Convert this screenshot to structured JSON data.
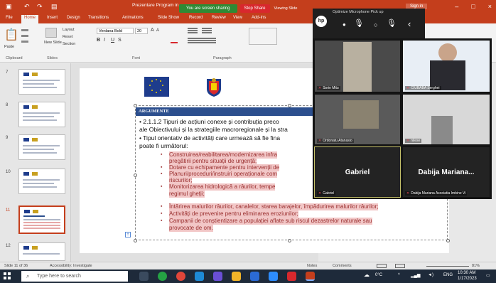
{
  "window": {
    "title": "Prezentare Program in...",
    "signin": "Sign in",
    "controls": [
      "–",
      "□",
      "×"
    ]
  },
  "sharing": {
    "status": "You are screen sharing",
    "stop": "Stop Share",
    "viewing": "Viewing Slide"
  },
  "ribbon": {
    "tabs": [
      "File",
      "Home",
      "Insert",
      "Design",
      "Transitions",
      "Animations",
      "Slide Show",
      "Record",
      "Review",
      "View",
      "Add-ins"
    ],
    "groups": [
      "Clipboard",
      "Slides",
      "Font",
      "Paragraph"
    ],
    "clipboard": {
      "paste": "Paste"
    },
    "slides": {
      "new_slide": "New Slide",
      "layout": "Layout",
      "reset": "Reset",
      "section": "Section"
    },
    "font": {
      "name": "Verdana Bold",
      "size": "20"
    }
  },
  "zoom_toolbar": {
    "label": "Optimize Microphone Pick up"
  },
  "thumbnails": [
    {
      "num": "7"
    },
    {
      "num": "8"
    },
    {
      "num": "9"
    },
    {
      "num": "10"
    },
    {
      "num": "11"
    },
    {
      "num": "12"
    }
  ],
  "slide": {
    "header": "ARGUMENTE",
    "line1": "• 2.1.1.2 Tipuri de acțiuni conexe și contribuția preco",
    "line2": "ale Obiectivului și la strategiile macroregionale și la stra",
    "line3": "• Tipul orientativ de activități care urmează să fie fina",
    "line4": "poate fi următorul:",
    "bullets": [
      [
        "Construirea/reabilitarea/modernizarea  infra",
        "pregătirii pentru situații de urgență;"
      ],
      [
        "Dotare cu echipamente pentru intervenții de"
      ],
      [
        "Planuri/proceduri/instruiri operaționale com",
        "riscurilor;"
      ],
      [
        "Monitorizarea  hidrologică  a  râurilor,  tempe",
        "regimul gheții;"
      ],
      [
        "Întărirea malurilor râurilor, canalelor, starea barajelor, împădurirea malurilor râurilor;"
      ],
      [
        "Activități de prevenire pentru eliminarea eroziunilor;"
      ],
      [
        "Campanii  de  conștientizare  a  populației  aflate  sub  riscul  dezastrelor  naturale  sau",
        "provocate de om."
      ]
    ]
  },
  "participants": [
    {
      "name": "Sorin Mitu"
    },
    {
      "name": "CIUBABA Serghei"
    },
    {
      "name": "Ordonatu Atanasio"
    },
    {
      "name": "nilese"
    },
    {
      "name": "Gabriel",
      "big": "Gabriel"
    },
    {
      "name": "Dabija Mariana Asociatia Imbine Vi",
      "big": "Dabija Mariana..."
    }
  ],
  "statusbar": {
    "slide_of": "Slide 11 of 36",
    "accessibility": "Accessibility: Investigate",
    "notes": "Notes",
    "comments": "Comments",
    "zoom": "81%"
  },
  "taskbar": {
    "search": "Type here to search",
    "weather": "0°C",
    "lang": "ENG",
    "time": "10:30 AM",
    "date": "1/17/2023"
  },
  "colors": {
    "accent": "#c43e1c",
    "argbar": "#2c4f8e",
    "redtext": "#9a2f2f",
    "share_green": "#2f8a34",
    "share_red": "#d8282d"
  }
}
